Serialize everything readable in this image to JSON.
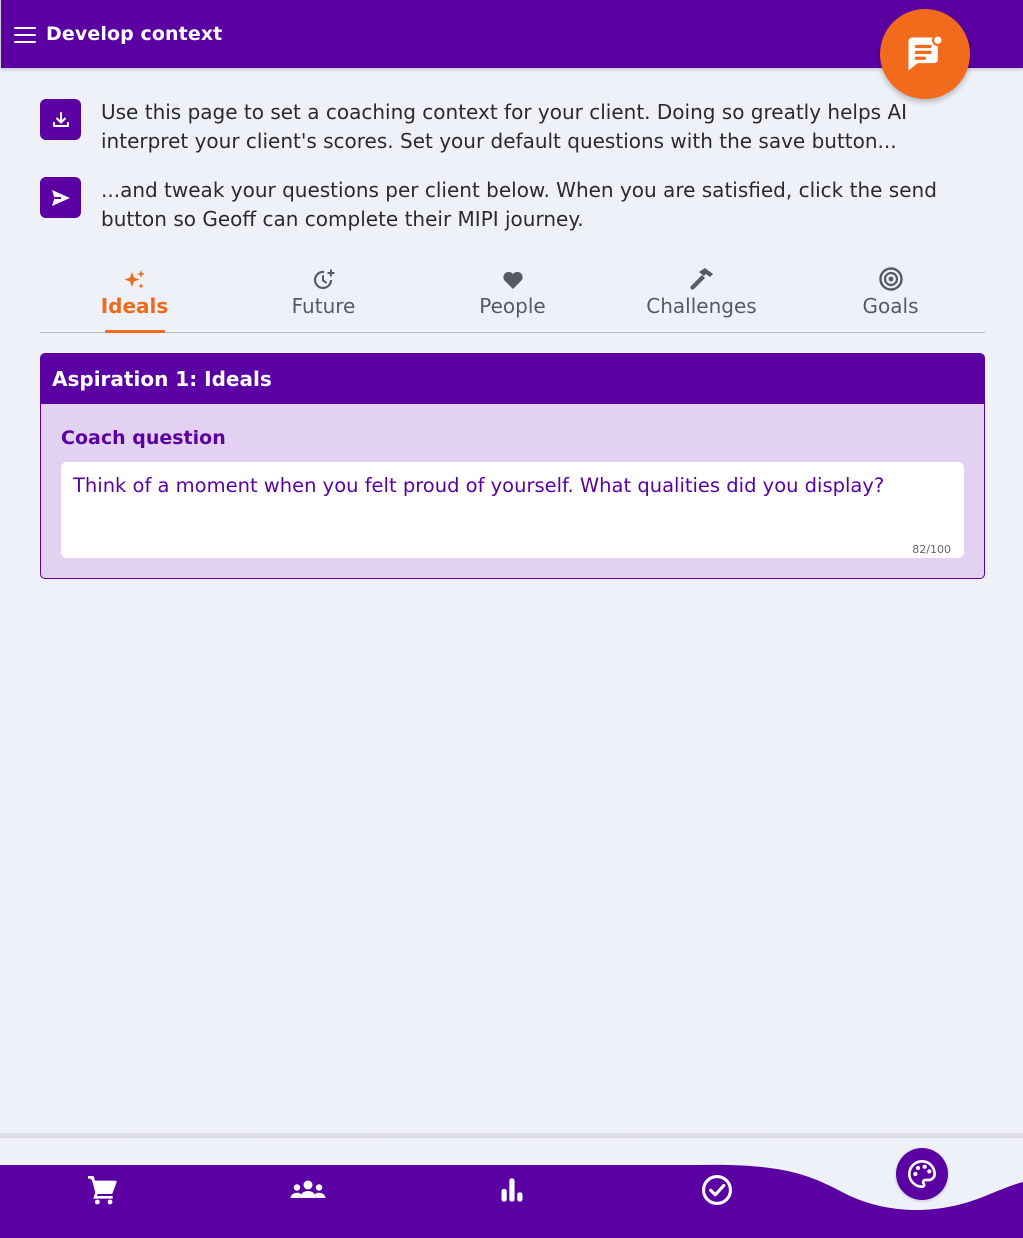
{
  "header": {
    "title": "Develop context",
    "menu_icon": "menu-icon",
    "fab_icon": "chat-icon"
  },
  "info": [
    {
      "icon": "download-icon",
      "text": "Use this page to set a coaching context for your client. Doing so greatly helps AI interpret your client's scores. Set your default questions with the save button..."
    },
    {
      "icon": "send-icon",
      "text": "...and tweak your questions per client below. When you are satisfied, click the send button so Geoff can complete their MIPI journey."
    }
  ],
  "tabs": [
    {
      "label": "Ideals",
      "icon": "sparkles-icon",
      "active": true
    },
    {
      "label": "Future",
      "icon": "future-clock-icon",
      "active": false
    },
    {
      "label": "People",
      "icon": "heart-icon",
      "active": false
    },
    {
      "label": "Challenges",
      "icon": "hammer-icon",
      "active": false
    },
    {
      "label": "Goals",
      "icon": "target-icon",
      "active": false
    }
  ],
  "card": {
    "title": "Aspiration 1: Ideals",
    "label": "Coach question",
    "value": "Think of a moment when you felt proud of yourself. What qualities did you display?",
    "counter": "82/100"
  },
  "bottom_nav": {
    "items": [
      "cart-icon",
      "group-icon",
      "chart-icon",
      "check-circle-icon"
    ],
    "palette_icon": "palette-icon"
  },
  "colors": {
    "primary": "#5b00a3",
    "accent": "#f26a1b",
    "card_bg": "#e3d1f1",
    "page_bg": "#eef1f7"
  }
}
